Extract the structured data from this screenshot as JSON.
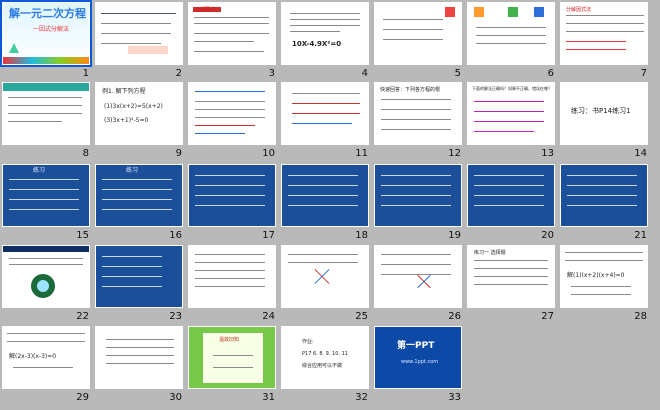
{
  "slides": [
    {
      "n": "1",
      "title": "解一元二次方程",
      "subtitle": "一因式分解法"
    },
    {
      "n": "2"
    },
    {
      "n": "3",
      "label": "分解因式"
    },
    {
      "n": "4",
      "eq": "10X-4.9X²=0"
    },
    {
      "n": "5"
    },
    {
      "n": "6"
    },
    {
      "n": "7",
      "label": "分解因式法"
    },
    {
      "n": "8"
    },
    {
      "n": "9",
      "ex": "例1. 解下列方程",
      "e1": "(1)3x(x+2)=5(x+2)",
      "e2": "(3)3x+1)²-5=0"
    },
    {
      "n": "10"
    },
    {
      "n": "11"
    },
    {
      "n": "12",
      "q": "快速回答：下列各方程的根"
    },
    {
      "n": "13",
      "q": "下面的解法正确吗？如果不正确，错误在哪？"
    },
    {
      "n": "14",
      "text": "练习：书P14练习1"
    },
    {
      "n": "15",
      "word": "练习"
    },
    {
      "n": "16",
      "word": "练习"
    },
    {
      "n": "17"
    },
    {
      "n": "18"
    },
    {
      "n": "19"
    },
    {
      "n": "20"
    },
    {
      "n": "21"
    },
    {
      "n": "22"
    },
    {
      "n": "23"
    },
    {
      "n": "24"
    },
    {
      "n": "25"
    },
    {
      "n": "26"
    },
    {
      "n": "27",
      "q": "练习一 选择题"
    },
    {
      "n": "28",
      "sol": "解(1)(x+2)(x+4)=0"
    },
    {
      "n": "29",
      "sol": "解(2x-3)(x-3)=0"
    },
    {
      "n": "30"
    },
    {
      "n": "31",
      "quote": "温故旧知"
    },
    {
      "n": "32",
      "hw": "作业:",
      "hw2": "P17 6. 8. 9. 10. 11",
      "hw3": "综合应用可以不做"
    },
    {
      "n": "33",
      "brand": "第一PPT",
      "site": "www.1ppt.com"
    }
  ]
}
